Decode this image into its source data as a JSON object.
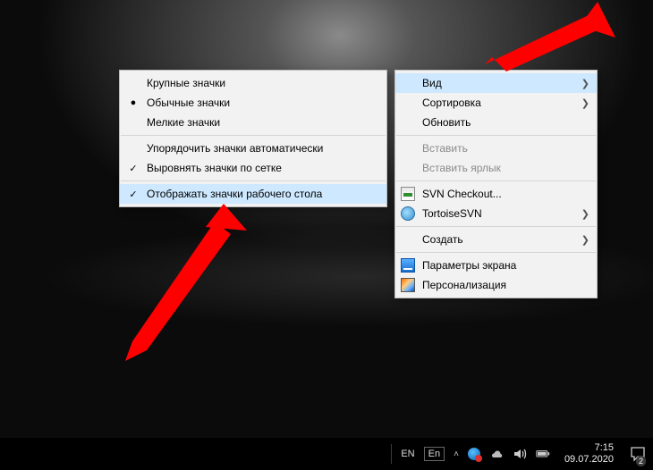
{
  "submenu": {
    "items": {
      "large": "Крупные значки",
      "medium": "Обычные значки",
      "small": "Мелкие значки",
      "autoarrange": "Упорядочить значки автоматически",
      "aligngrid": "Выровнять значки по сетке",
      "showicons": "Отображать значки рабочего стола"
    }
  },
  "mainmenu": {
    "view": "Вид",
    "sort": "Сортировка",
    "refresh": "Обновить",
    "paste": "Вставить",
    "pasteshortcut": "Вставить ярлык",
    "svncheckout": "SVN Checkout...",
    "tortoisesvn": "TortoiseSVN",
    "create": "Создать",
    "displaysettings": "Параметры экрана",
    "personalize": "Персонализация"
  },
  "taskbar": {
    "lang1": "EN",
    "lang2": "En",
    "time": "7:15",
    "date": "09.07.2020",
    "notif_count": "2"
  }
}
